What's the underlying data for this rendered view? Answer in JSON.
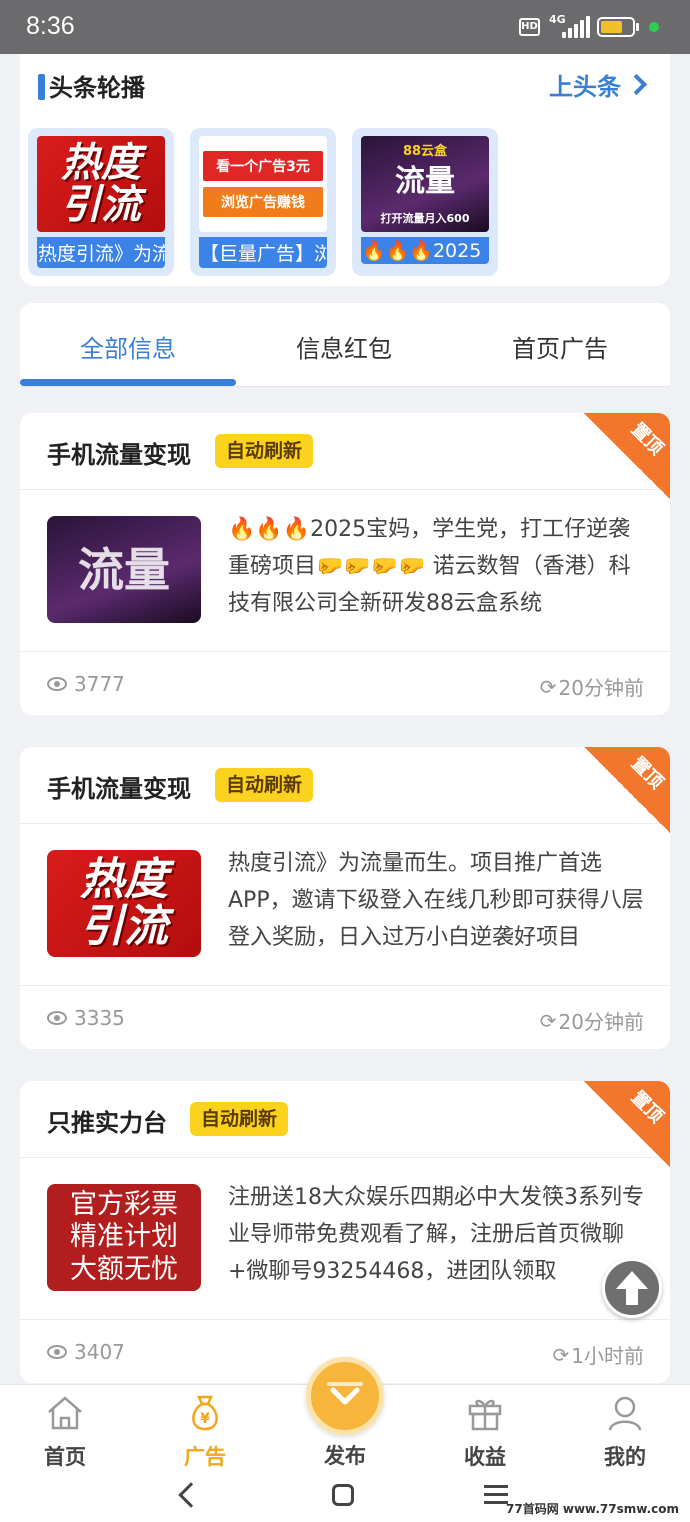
{
  "status_bar": {
    "time": "8:36",
    "hd": "HD",
    "network": "4G",
    "battery_level": 0.7,
    "colors": {
      "battery": "#f3c02c",
      "dot": "#2ecc55"
    }
  },
  "headline": {
    "title": "头条轮播",
    "more_label": "上头条",
    "items": [
      {
        "img_lines": [
          "热度",
          "引流"
        ],
        "caption": "热度引流》为流量而生"
      },
      {
        "img_lines": [
          "看一个广告3元",
          "浏览广告赚钱"
        ],
        "caption": "【巨量广告】浏览广告"
      },
      {
        "img_top": "88云盒",
        "img_big": "流量",
        "img_sub": "打开流量月入600",
        "caption": "🔥🔥🔥2025"
      }
    ]
  },
  "tabs": [
    {
      "label": "全部信息",
      "active": true
    },
    {
      "label": "信息红包",
      "active": false
    },
    {
      "label": "首页广告",
      "active": false
    }
  ],
  "badges": {
    "auto_refresh": "自动刷新",
    "pinned": "置顶"
  },
  "posts": [
    {
      "title": "手机流量变现",
      "image": "purple",
      "image_text": "流量",
      "body": "🔥🔥🔥2025宝妈，学生党，打工仔逆袭重磅项目🤛🤛🤛🤛 诺云数智（香港）科技有限公司全新研发88云盒系统",
      "views": "3777",
      "time": "20分钟前"
    },
    {
      "title": "手机流量变现",
      "image": "redflow",
      "image_lines": [
        "热度",
        "引流"
      ],
      "body": "热度引流》为流量而生。项目推广首选APP，邀请下级登入在线几秒即可获得八层登入奖励，日入过万小白逆袭好项目",
      "views": "3335",
      "time": "20分钟前"
    },
    {
      "title": "只推实力台",
      "image": "lottery",
      "image_lines": [
        "官方彩票",
        "精准计划",
        "大额无忧"
      ],
      "body": "注册送18大众娱乐四期必中大发筷3系列专业导师带免费观看了解，注册后首页微聊+微聊号93254468，进团队领取",
      "views": "3407",
      "time": "1小时前"
    }
  ],
  "bottom_nav": [
    {
      "label": "首页",
      "icon": "home-icon",
      "active": false
    },
    {
      "label": "广告",
      "icon": "money-bag-icon",
      "active": true
    },
    {
      "label": "发布",
      "icon": "publish-icon",
      "active": false
    },
    {
      "label": "收益",
      "icon": "gift-icon",
      "active": false
    },
    {
      "label": "我的",
      "icon": "user-icon",
      "active": false
    }
  ],
  "watermark": "77首码网 www.77smw.com",
  "colors": {
    "accent": "#3a7fd6",
    "badge": "#fbd21e",
    "pin": "#f2762c",
    "nav_active": "#f3a51b"
  }
}
